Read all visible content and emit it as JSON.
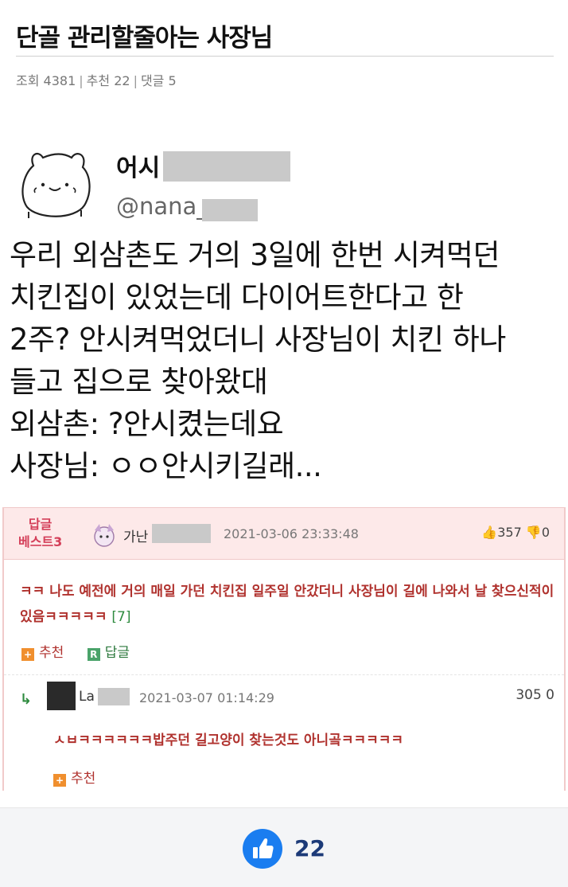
{
  "post": {
    "title": "단골 관리할줄아는 사장님",
    "views_label": "조회",
    "views": "4381",
    "recommend_label": "추천",
    "recommend": "22",
    "comments_label": "댓글",
    "comments": "5"
  },
  "tweet": {
    "name_prefix": "어시",
    "handle_prefix": "@nana_",
    "lines": [
      "우리 외삼촌도 거의 3일에 한번 시켜먹던",
      "치킨집이 있었는데 다이어트한다고 한",
      "2주? 안시켜먹었더니 사장님이 치킨 하나",
      "들고 집으로 찾아왔대",
      "외삼촌: ?안시켰는데요",
      "사장님: ㅇㅇ안시키길래..."
    ]
  },
  "best_comment": {
    "badge_line1": "답글",
    "badge_line2": "베스트3",
    "author_prefix": "가난",
    "date": "2021-03-06 23:33:48",
    "up": "357",
    "down": "0",
    "text": "ㅋㅋ 나도 예전에 거의 매일 가던 치킨집 일주일 안갔더니 사장님이 길에 나와서 날 찾으신적이 있음ㅋㅋㅋㅋㅋ",
    "reply_count": "[7]",
    "recommend_label": "추천",
    "reply_label": "답글"
  },
  "reply": {
    "author_prefix": "La",
    "date": "2021-03-07 01:14:29",
    "votes": "305 0",
    "text": "ㅅㅂㅋㅋㅋㅋㅋㅋ밥주던 길고양이 찾는것도 아니곸ㅋㅋㅋㅋㅋ",
    "recommend_label": "추천"
  },
  "footer": {
    "like_count": "22"
  },
  "colors": {
    "accent": "#1a7df0",
    "comment_red": "#b0322e",
    "best_pink": "#fde9e9"
  }
}
